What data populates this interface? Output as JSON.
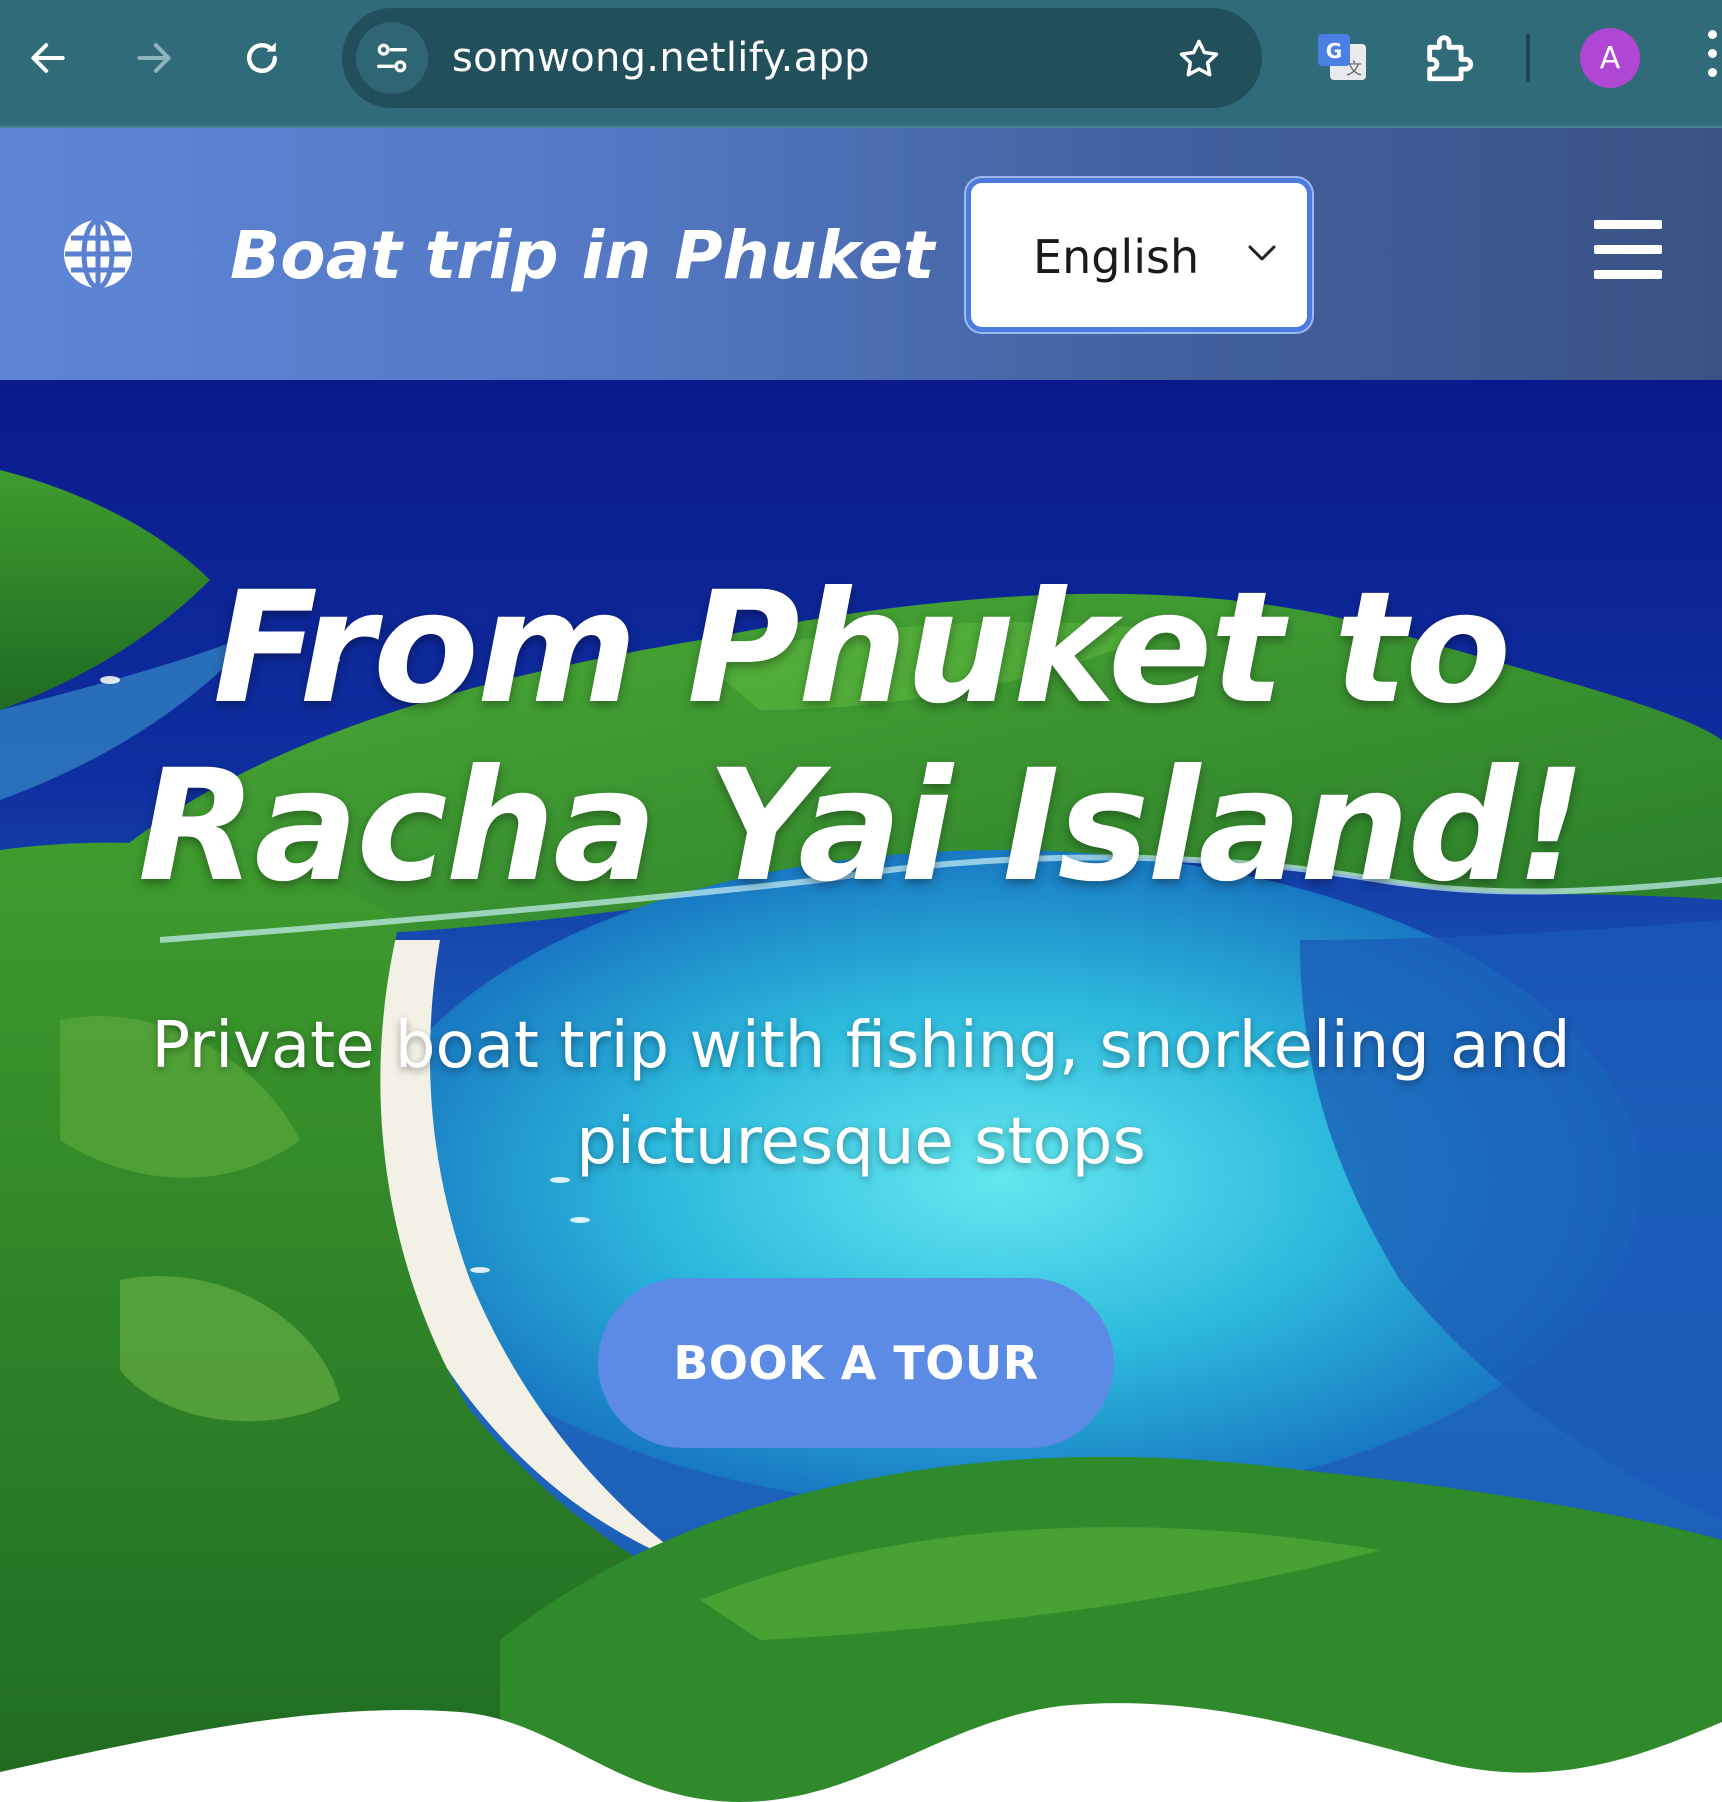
{
  "browser": {
    "url": "somwong.netlify.app",
    "profile_initial": "A",
    "icons": {
      "back": "arrow-left-icon",
      "forward": "arrow-right-icon",
      "reload": "reload-icon",
      "site_info": "tune-icon",
      "bookmark": "star-icon",
      "translate": "google-translate-icon",
      "extensions": "puzzle-icon",
      "menu": "kebab-menu-icon"
    }
  },
  "header": {
    "logo_icon": "globe-icon",
    "title": "Boat trip in Phuket",
    "language": {
      "selected": "English"
    },
    "menu_icon": "hamburger-menu-icon"
  },
  "hero": {
    "title_line1": "From Phuket to",
    "title_line2": "Racha Yai Island!",
    "subtitle": "Private boat trip with fishing, snorkeling and picturesque stops",
    "cta_label": "BOOK A TOUR"
  },
  "colors": {
    "chrome_bg": "#2f6b78",
    "omnibox_bg": "#214f5a",
    "header_gradient_start": "#5d86d6",
    "header_gradient_end": "#3a5385",
    "cta_bg": "#5b8be4",
    "avatar_bg": "#b046d4"
  }
}
